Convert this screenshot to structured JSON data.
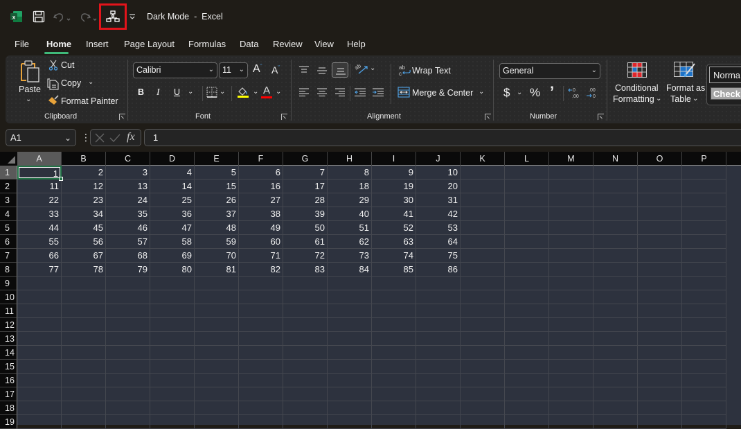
{
  "titlebar": {
    "document_name": "Dark Mode",
    "separator": "-",
    "app_name": "Excel",
    "title_full": "Dark Mode  -  Excel"
  },
  "menu": {
    "tabs": [
      {
        "label": "File",
        "active": false
      },
      {
        "label": "Home",
        "active": true
      },
      {
        "label": "Insert",
        "active": false
      },
      {
        "label": "Page Layout",
        "active": false
      },
      {
        "label": "Formulas",
        "active": false
      },
      {
        "label": "Data",
        "active": false
      },
      {
        "label": "Review",
        "active": false
      },
      {
        "label": "View",
        "active": false
      },
      {
        "label": "Help",
        "active": false
      }
    ]
  },
  "ribbon": {
    "clipboard": {
      "label": "Clipboard",
      "paste": "Paste",
      "cut": "Cut",
      "copy": "Copy",
      "format_painter": "Format Painter"
    },
    "font": {
      "label": "Font",
      "font_name": "Calibri",
      "font_size": "11",
      "bold": "B",
      "italic": "I",
      "underline": "U",
      "font_color_letter": "A",
      "highlight_color": "#ffff00",
      "font_color": "#ff0000"
    },
    "alignment": {
      "label": "Alignment",
      "wrap_text": "Wrap Text",
      "merge_center": "Merge & Center"
    },
    "number": {
      "label": "Number",
      "format": "General",
      "currency": "$",
      "percent": "%",
      "comma": "’"
    },
    "styles": {
      "conditional_formatting_line1": "Conditional",
      "conditional_formatting_line2": "Formatting",
      "format_as_table_line1": "Format as",
      "format_as_table_line2": "Table",
      "normal": "Norma",
      "check": "Check"
    }
  },
  "formula_bar": {
    "name_box": "A1",
    "fx": "fx",
    "formula_value": "1"
  },
  "sheet": {
    "columns": [
      "A",
      "B",
      "C",
      "D",
      "E",
      "F",
      "G",
      "H",
      "I",
      "J",
      "K",
      "L",
      "M",
      "N",
      "O",
      "P"
    ],
    "row_numbers": [
      "1",
      "2",
      "3",
      "4",
      "5",
      "6",
      "7",
      "8",
      "9",
      "10",
      "11",
      "12",
      "13",
      "14",
      "15",
      "16",
      "17",
      "18",
      "19"
    ],
    "selected_cell": "A1",
    "data": [
      [
        1,
        2,
        3,
        4,
        5,
        6,
        7,
        8,
        9,
        10
      ],
      [
        11,
        12,
        13,
        14,
        15,
        16,
        17,
        18,
        19,
        20
      ],
      [
        22,
        23,
        24,
        25,
        26,
        27,
        28,
        29,
        30,
        31
      ],
      [
        33,
        34,
        35,
        36,
        37,
        38,
        39,
        40,
        41,
        42
      ],
      [
        44,
        45,
        46,
        47,
        48,
        49,
        50,
        51,
        52,
        53
      ],
      [
        55,
        56,
        57,
        58,
        59,
        60,
        61,
        62,
        63,
        64
      ],
      [
        66,
        67,
        68,
        69,
        70,
        71,
        72,
        73,
        74,
        75
      ],
      [
        77,
        78,
        79,
        80,
        81,
        82,
        83,
        84,
        85,
        86
      ]
    ]
  },
  "colors": {
    "accent_green": "#3fb97a",
    "selection_green": "#217346",
    "highlight_red": "#e3141b",
    "grid_bg": "#2d323e"
  }
}
